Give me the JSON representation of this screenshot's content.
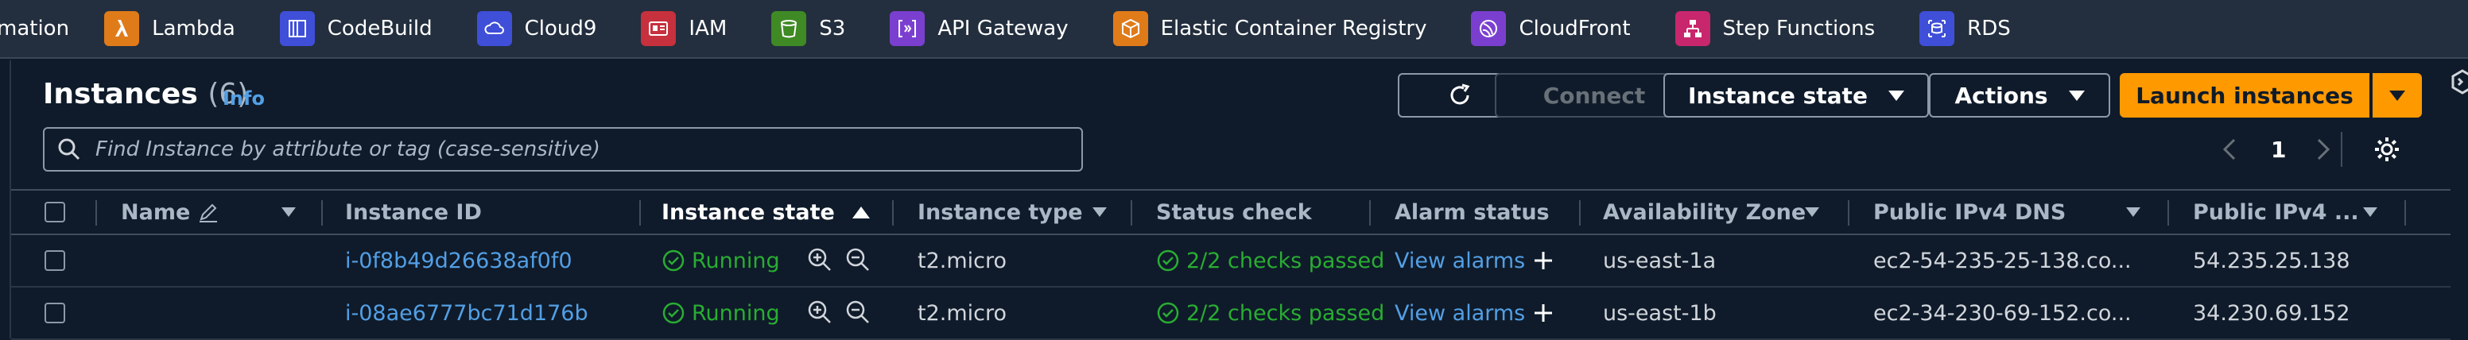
{
  "services": [
    {
      "label": "mation",
      "icon": "",
      "color": ""
    },
    {
      "label": "Lambda",
      "icon": "lambda-icon",
      "color": "#e07b1a"
    },
    {
      "label": "CodeBuild",
      "icon": "codebuild-icon",
      "color": "#3f4fd8"
    },
    {
      "label": "Cloud9",
      "icon": "cloud9-icon",
      "color": "#3f4fd8"
    },
    {
      "label": "IAM",
      "icon": "iam-icon",
      "color": "#c7303d"
    },
    {
      "label": "S3",
      "icon": "s3-icon",
      "color": "#3f8a24"
    },
    {
      "label": "API Gateway",
      "icon": "api-gateway-icon",
      "color": "#7b3fd0"
    },
    {
      "label": "Elastic Container Registry",
      "icon": "ecr-icon",
      "color": "#e07b1a"
    },
    {
      "label": "CloudFront",
      "icon": "cloudfront-icon",
      "color": "#7b3fd0"
    },
    {
      "label": "Step Functions",
      "icon": "step-functions-icon",
      "color": "#c8266d"
    },
    {
      "label": "RDS",
      "icon": "rds-icon",
      "color": "#3f4fd8"
    }
  ],
  "header": {
    "title": "Instances",
    "count": "(6)",
    "info": "Info",
    "connect": "Connect",
    "instance_state": "Instance state",
    "actions": "Actions",
    "launch": "Launch instances"
  },
  "search": {
    "placeholder": "Find Instance by attribute or tag (case-sensitive)"
  },
  "pagination": {
    "page": "1"
  },
  "columns": [
    "Name",
    "Instance ID",
    "Instance state",
    "Instance type",
    "Status check",
    "Alarm status",
    "Availability Zone",
    "Public IPv4 DNS",
    "Public IPv4 ..."
  ],
  "rows": [
    {
      "id": "i-0f8b49d26638af0f0",
      "state": "Running",
      "type": "t2.micro",
      "status": "2/2 checks passed",
      "alarm": "View alarms",
      "zone": "us-east-1a",
      "dns": "ec2-54-235-25-138.co...",
      "ip": "54.235.25.138"
    },
    {
      "id": "i-08ae6777bc71d176b",
      "state": "Running",
      "type": "t2.micro",
      "status": "2/2 checks passed",
      "alarm": "View alarms",
      "zone": "us-east-1b",
      "dns": "ec2-34-230-69-152.co...",
      "ip": "34.230.69.152"
    }
  ],
  "colors": {
    "accent": "#ff9900",
    "link": "#539fe5",
    "running": "#29ad32"
  }
}
